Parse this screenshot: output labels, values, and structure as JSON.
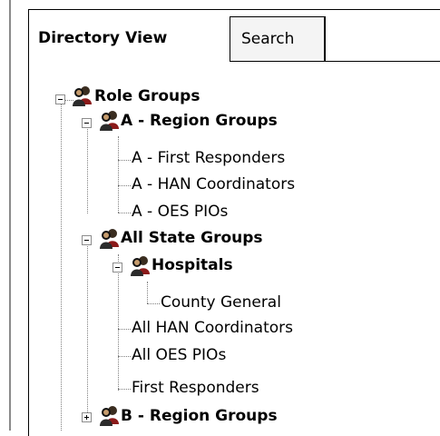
{
  "tabs": {
    "directory_view": "Directory View",
    "search": "Search"
  },
  "tree": {
    "role_groups": "Role Groups",
    "a_region_groups": "A - Region Groups",
    "a_first_responders": "A - First Responders",
    "a_han_coordinators": "A - HAN Coordinators",
    "a_oes_pios": "A - OES PIOs",
    "all_state_groups": "All State Groups",
    "hospitals": "Hospitals",
    "county_general": "County General",
    "all_han_coordinators": "All HAN Coordinators",
    "all_oes_pios": "All OES PIOs",
    "first_responders": "First Responders",
    "b_region_groups": "B - Region Groups"
  },
  "icons": {
    "group": "group-people-icon",
    "expand": "plus-box-icon",
    "collapse": "minus-box-icon"
  },
  "colors": {
    "tree_line": "#808080",
    "border": "#000000",
    "search_tab_bg": "#f4f4f4"
  }
}
